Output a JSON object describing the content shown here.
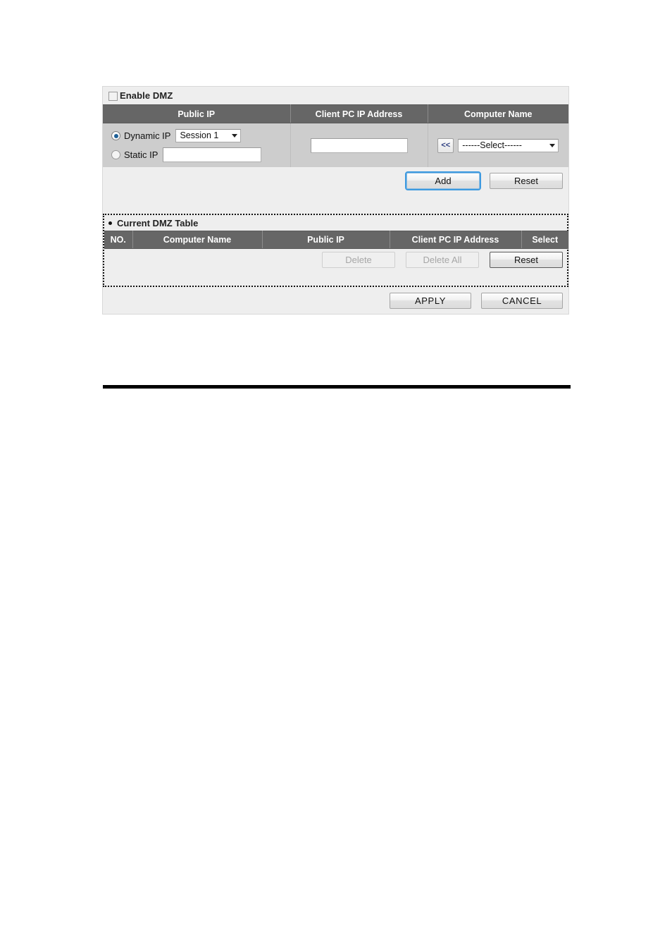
{
  "panel": {
    "enable_dmz": {
      "label": "Enable DMZ",
      "checked": false
    },
    "form_headers": {
      "public_ip": "Public IP",
      "client_pc_ip_address": "Client PC IP Address",
      "computer_name": "Computer Name"
    },
    "public_ip": {
      "dynamic_label": "Dynamic IP",
      "dynamic_selected": true,
      "session_select_value": "Session 1",
      "static_label": "Static IP",
      "static_selected": false,
      "static_value": ""
    },
    "client_pc_ip": {
      "value": ""
    },
    "computer_name": {
      "shift_button_label": "<<",
      "select_value": "------Select------"
    },
    "buttons": {
      "add": "Add",
      "reset": "Reset"
    }
  },
  "current_dmz_table": {
    "title": "Current DMZ Table",
    "headers": {
      "no": "NO.",
      "computer_name": "Computer Name",
      "public_ip": "Public IP",
      "client_pc_ip_address": "Client PC IP Address",
      "select": "Select"
    },
    "rows": [],
    "buttons": {
      "delete": "Delete",
      "delete_all": "Delete All",
      "reset": "Reset"
    }
  },
  "footer": {
    "apply": "APPLY",
    "cancel": "CANCEL"
  },
  "colors": {
    "header_bg": "#666666",
    "panel_bg": "#eeeeee",
    "field_row_bg": "#cdcdcd",
    "focus_ring": "#3d9ae0",
    "radio_dot": "#1d5f96"
  }
}
